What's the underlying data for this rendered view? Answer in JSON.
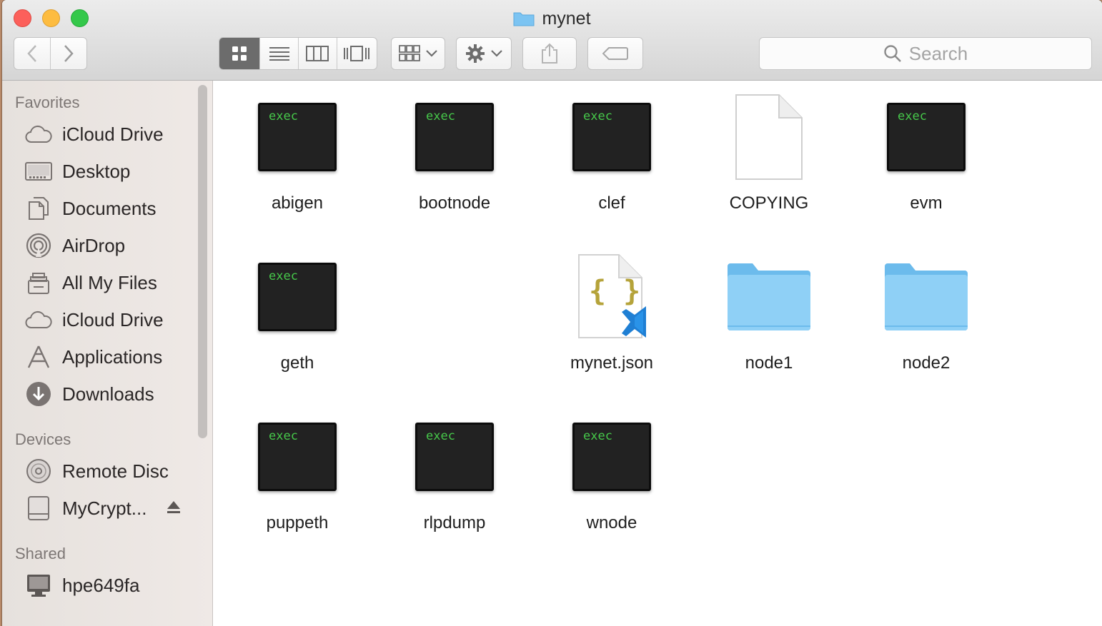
{
  "window": {
    "title": "mynet"
  },
  "toolbar": {
    "search_placeholder": "Search",
    "view_modes": [
      "icon",
      "list",
      "column",
      "coverflow"
    ],
    "active_view": "icon"
  },
  "sidebar": {
    "favorites_label": "Favorites",
    "favorites": [
      {
        "label": "iCloud Drive",
        "icon": "cloud-icon"
      },
      {
        "label": "Desktop",
        "icon": "desktop-icon"
      },
      {
        "label": "Documents",
        "icon": "documents-icon"
      },
      {
        "label": "AirDrop",
        "icon": "airdrop-icon"
      },
      {
        "label": "All My Files",
        "icon": "all-files-icon"
      },
      {
        "label": "iCloud Drive",
        "icon": "cloud-icon"
      },
      {
        "label": "Applications",
        "icon": "applications-icon"
      },
      {
        "label": "Downloads",
        "icon": "downloads-icon"
      }
    ],
    "devices_label": "Devices",
    "devices": [
      {
        "label": "Remote Disc",
        "icon": "disc-icon"
      },
      {
        "label": "MyCrypt...",
        "icon": "drive-icon"
      }
    ],
    "shared_label": "Shared",
    "shared": [
      {
        "label": "hpe649fa",
        "icon": "computer-icon"
      }
    ]
  },
  "files": [
    {
      "name": "abigen",
      "type": "exec",
      "badge": "exec"
    },
    {
      "name": "bootnode",
      "type": "exec",
      "badge": "exec"
    },
    {
      "name": "clef",
      "type": "exec",
      "badge": "exec"
    },
    {
      "name": "COPYING",
      "type": "document"
    },
    {
      "name": "evm",
      "type": "exec",
      "badge": "exec"
    },
    {
      "name": "geth",
      "type": "exec",
      "badge": "exec"
    },
    {
      "name": "mynet.json",
      "type": "json",
      "glyph": "{ }"
    },
    {
      "name": "node1",
      "type": "folder"
    },
    {
      "name": "node2",
      "type": "folder"
    },
    {
      "name": "puppeth",
      "type": "exec",
      "badge": "exec"
    },
    {
      "name": "rlpdump",
      "type": "exec",
      "badge": "exec"
    },
    {
      "name": "wnode",
      "type": "exec",
      "badge": "exec"
    }
  ],
  "colors": {
    "folder": "#6fc0f0",
    "exec_text": "#46c84a",
    "json_brace": "#b5a33a"
  }
}
